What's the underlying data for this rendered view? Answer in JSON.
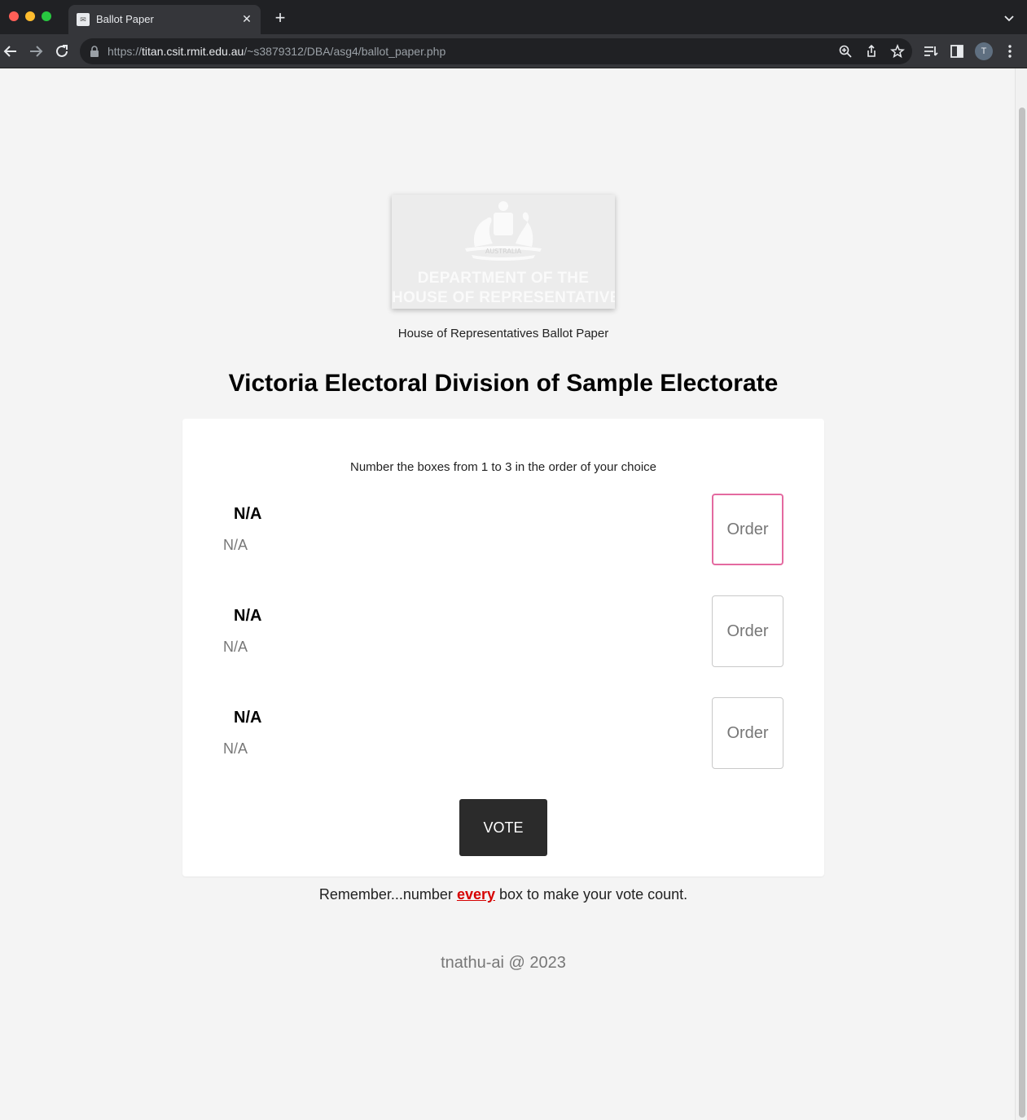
{
  "browser": {
    "tab_title": "Ballot Paper",
    "url_scheme": "https://",
    "url_host": "titan.csit.rmit.edu.au",
    "url_path": "/~s3879312/DBA/asg4/ballot_paper.php",
    "profile_initial": "T"
  },
  "logo": {
    "crest_label": "AUSTRALIA",
    "line1": "DEPARTMENT OF THE",
    "line2": "HOUSE OF REPRESENTATIVES"
  },
  "page": {
    "subtitle": "House of Representatives Ballot Paper",
    "heading": "Victoria Electoral Division of Sample Electorate"
  },
  "ballot": {
    "instruction": "Number the boxes from 1 to 3 in the order of your choice",
    "candidates": [
      {
        "name": "N/A",
        "party": "N/A",
        "placeholder": "Order"
      },
      {
        "name": "N/A",
        "party": "N/A",
        "placeholder": "Order"
      },
      {
        "name": "N/A",
        "party": "N/A",
        "placeholder": "Order"
      }
    ],
    "vote_label": "VOTE"
  },
  "reminder": {
    "before": "Remember...number ",
    "emphasis": "every",
    "after": " box to make your vote count."
  },
  "footer": {
    "text": "tnathu-ai @ 2023"
  },
  "colors": {
    "focus_border": "#e46aa0",
    "emphasis": "#d60000",
    "vote_button": "#2b2b2b"
  }
}
